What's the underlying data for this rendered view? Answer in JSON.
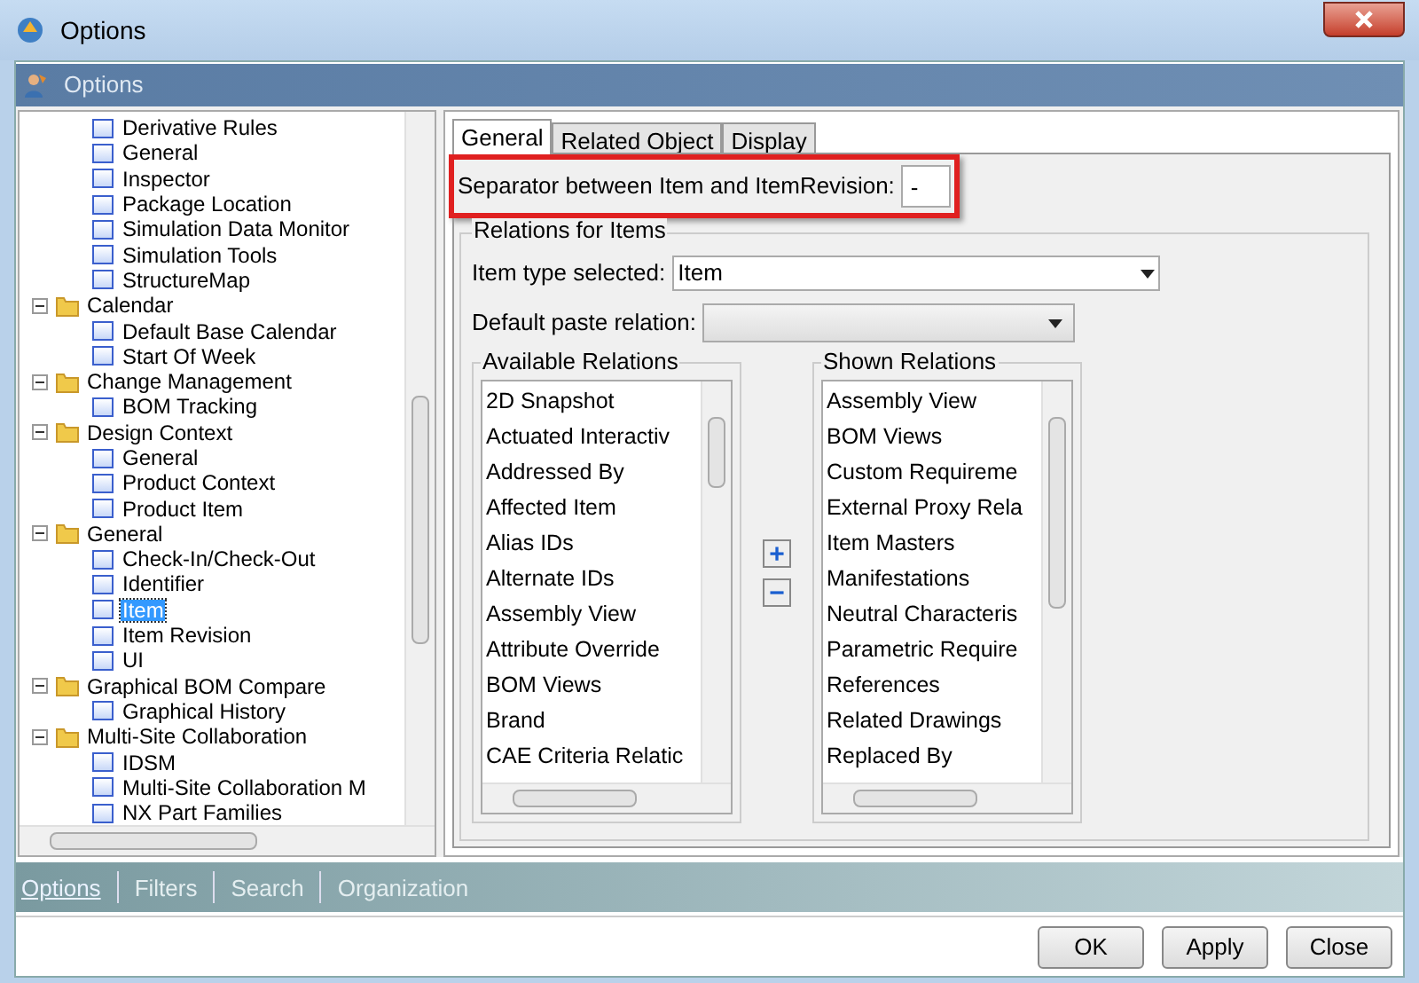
{
  "window": {
    "title": "Options"
  },
  "header": {
    "title": "Options"
  },
  "tree": [
    {
      "kind": "partial",
      "children": [
        {
          "label": "Derivative Rules",
          "selected": false
        },
        {
          "label": "General",
          "selected": false
        },
        {
          "label": "Inspector",
          "selected": false
        },
        {
          "label": "Package Location",
          "selected": false
        },
        {
          "label": "Simulation Data Monitor",
          "selected": false
        },
        {
          "label": "Simulation Tools",
          "selected": false
        },
        {
          "label": "StructureMap",
          "selected": false
        }
      ]
    },
    {
      "kind": "folder",
      "label": "Calendar",
      "expanded": true,
      "children": [
        {
          "label": "Default Base Calendar",
          "selected": false
        },
        {
          "label": "Start Of Week",
          "selected": false
        }
      ]
    },
    {
      "kind": "folder",
      "label": "Change Management",
      "expanded": true,
      "children": [
        {
          "label": "BOM Tracking",
          "selected": false
        }
      ]
    },
    {
      "kind": "folder",
      "label": "Design Context",
      "expanded": true,
      "children": [
        {
          "label": "General",
          "selected": false
        },
        {
          "label": "Product Context",
          "selected": false
        },
        {
          "label": "Product Item",
          "selected": false
        }
      ]
    },
    {
      "kind": "folder",
      "label": "General",
      "expanded": true,
      "children": [
        {
          "label": "Check-In/Check-Out",
          "selected": false
        },
        {
          "label": "Identifier",
          "selected": false
        },
        {
          "label": "Item",
          "selected": true
        },
        {
          "label": "Item Revision",
          "selected": false
        },
        {
          "label": "UI",
          "selected": false
        }
      ]
    },
    {
      "kind": "folder",
      "label": "Graphical BOM Compare",
      "expanded": true,
      "children": [
        {
          "label": "Graphical History",
          "selected": false
        }
      ]
    },
    {
      "kind": "folder",
      "label": "Multi-Site Collaboration",
      "expanded": true,
      "children": [
        {
          "label": "IDSM",
          "selected": false
        },
        {
          "label": "Multi-Site Collaboration M",
          "selected": false
        },
        {
          "label": "NX Part Families",
          "selected": false
        }
      ]
    }
  ],
  "tabs": [
    {
      "label": "General",
      "selected": true
    },
    {
      "label": "Related Object",
      "selected": false
    },
    {
      "label": "Display",
      "selected": false
    }
  ],
  "separator": {
    "label": "Separator between Item and ItemRevision:",
    "value": "-"
  },
  "relations": {
    "title": "Relations for Items",
    "item_type": {
      "label": "Item type selected:",
      "value": "Item"
    },
    "paste_relation": {
      "label": "Default paste relation:"
    },
    "available": {
      "title": "Available Relations",
      "items": [
        "2D Snapshot",
        "Actuated Interactiv",
        "Addressed By",
        "Affected Item",
        "Alias IDs",
        "Alternate IDs",
        "Assembly View",
        "Attribute Override",
        "BOM Views",
        "Brand",
        "CAE Criteria Relatic"
      ]
    },
    "shown": {
      "title": "Shown Relations",
      "items": [
        "Assembly View",
        "BOM Views",
        "Custom Requireme",
        "External Proxy Rela",
        "Item Masters",
        "Manifestations",
        "Neutral Characteris",
        "Parametric Require",
        "References",
        "Related Drawings",
        "Replaced By"
      ]
    },
    "add_button": "+",
    "remove_button": "−"
  },
  "bottom_tabs": [
    {
      "label": "Options",
      "selected": true
    },
    {
      "label": "Filters",
      "selected": false
    },
    {
      "label": "Search",
      "selected": false
    },
    {
      "label": "Organization",
      "selected": false
    }
  ],
  "buttons": [
    "OK",
    "Apply",
    "Close"
  ]
}
